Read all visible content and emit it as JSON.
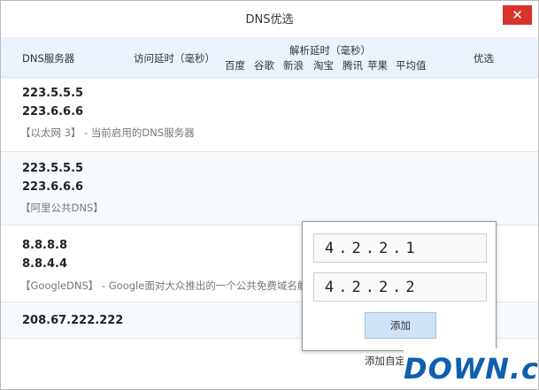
{
  "window": {
    "title": "DNS优选",
    "close_glyph": "✕"
  },
  "header": {
    "col_server": "DNS服务器",
    "col_latency": "访问延时（毫秒）",
    "col_resolve": "解析延时（毫秒）",
    "resolve_sites": [
      "百度",
      "谷歌",
      "新浪",
      "淘宝",
      "腾讯",
      "苹果",
      "平均值"
    ],
    "col_prefer": "优选"
  },
  "rows": [
    {
      "ips": [
        "223.5.5.5",
        "223.6.6.6"
      ],
      "desc": "【以太网 3】 - 当前启用的DNS服务器"
    },
    {
      "ips": [
        "223.5.5.5",
        "223.6.6.6"
      ],
      "desc": "【阿里公共DNS】"
    },
    {
      "ips": [
        "8.8.8.8",
        "8.8.4.4"
      ],
      "desc": "【GoogleDNS】 - Google面对大众推出的一个公共免费域名解析"
    },
    {
      "ips": [
        "208.67.222.222"
      ],
      "desc": ""
    }
  ],
  "popup": {
    "input_1": "4.2.2.1",
    "input_2": "4.2.2.2",
    "add_label": "添加"
  },
  "footer": {
    "add_custom_link": "添加自定"
  },
  "watermark": {
    "text": "DOWN.cc"
  }
}
